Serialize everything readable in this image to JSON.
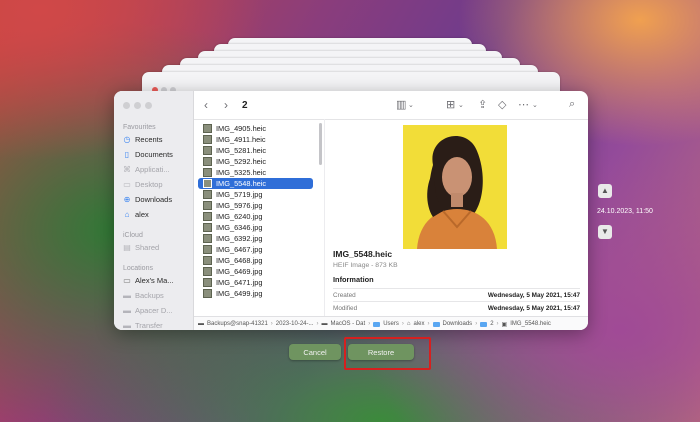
{
  "window": {
    "path_title": "2",
    "stack_path": "2"
  },
  "sidebar": {
    "favourites_header": "Favourites",
    "favourites": [
      {
        "label": "Recents",
        "icon": "clock-icon",
        "dim": false
      },
      {
        "label": "Documents",
        "icon": "document-icon",
        "dim": false
      },
      {
        "label": "Applicati...",
        "icon": "applications-icon",
        "dim": true
      },
      {
        "label": "Desktop",
        "icon": "desktop-icon",
        "dim": true
      },
      {
        "label": "Downloads",
        "icon": "download-icon",
        "dim": false
      },
      {
        "label": "alex",
        "icon": "home-icon",
        "dim": false
      }
    ],
    "icloud_header": "iCloud",
    "icloud": [
      {
        "label": "Shared",
        "icon": "shared-folder-icon",
        "dim": true
      }
    ],
    "locations_header": "Locations",
    "locations": [
      {
        "label": "Alex's Ma...",
        "icon": "laptop-icon",
        "dim": false
      },
      {
        "label": "Backups",
        "icon": "drive-icon",
        "dim": true
      },
      {
        "label": "Apacer D...",
        "icon": "drive-icon",
        "dim": true
      },
      {
        "label": "Transfer",
        "icon": "drive-icon",
        "dim": true
      }
    ]
  },
  "files": [
    "IMG_4905.heic",
    "IMG_4911.heic",
    "IMG_5281.heic",
    "IMG_5292.heic",
    "IMG_5325.heic",
    "IMG_5548.heic",
    "IMG_5719.jpg",
    "IMG_5976.jpg",
    "IMG_6240.jpg",
    "IMG_6346.jpg",
    "IMG_6392.jpg",
    "IMG_6467.jpg",
    "IMG_6468.jpg",
    "IMG_6469.jpg",
    "IMG_6471.jpg",
    "IMG_6499.jpg"
  ],
  "selected_index": 5,
  "preview": {
    "name": "IMG_5548.heic",
    "kind": "HEIF Image - 873 KB",
    "info_header": "Information",
    "created_label": "Created",
    "created_value": "Wednesday, 5 May 2021, 15:47",
    "modified_label": "Modified",
    "modified_value": "Wednesday, 5 May 2021, 15:47"
  },
  "pathbar": [
    "Backups@snap-41321",
    "2023-10-24-...",
    "MacOS - Dat",
    "Users",
    "alex",
    "Downloads",
    "2",
    "IMG_5548.heic"
  ],
  "buttons": {
    "cancel": "Cancel",
    "restore": "Restore"
  },
  "timeline": {
    "date": "24.10.2023, 11:50"
  }
}
